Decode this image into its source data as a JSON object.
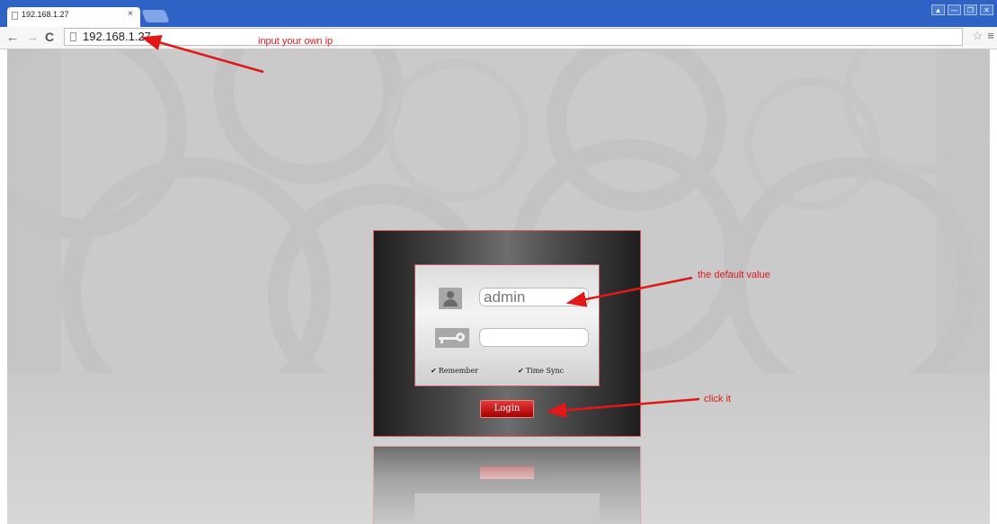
{
  "browser": {
    "tab_title": "192.168.1.27",
    "tab_close": "×",
    "address": "192.168.1.27",
    "nav_back": "←",
    "nav_forward": "→",
    "nav_reload": "C",
    "bookmark": "☆",
    "menu": "≡",
    "window_buttons": [
      "▲",
      "—",
      "❐",
      "✕"
    ]
  },
  "login": {
    "username_value": "admin",
    "password_value": "",
    "remember_label": "Remember",
    "timesync_label": "Time Sync",
    "check_mark": "✔",
    "login_label": "Login"
  },
  "annotations": {
    "ip_note": "input your own ip",
    "default_note": "the default value",
    "click_note": "click it"
  },
  "colors": {
    "annotation": "#e01818",
    "titlebar": "#2e62c4",
    "login_button": "#c80c0c"
  }
}
